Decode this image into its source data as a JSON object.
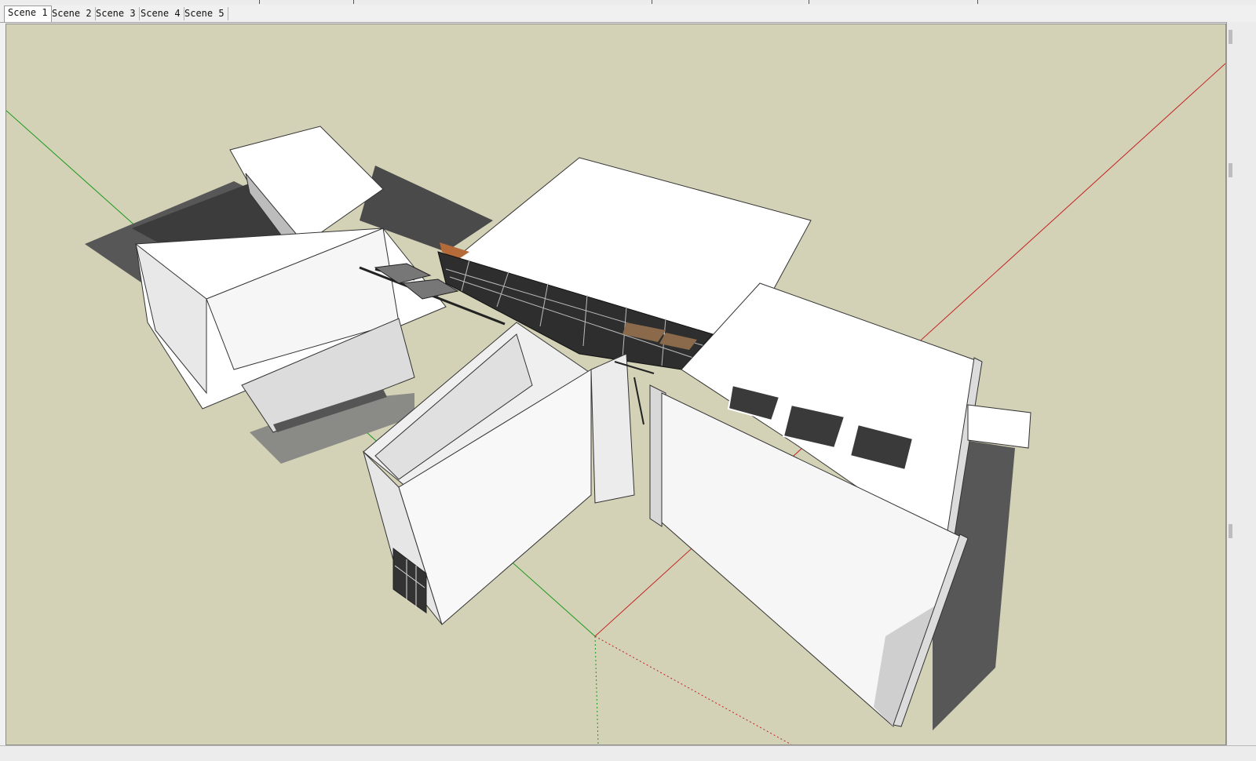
{
  "scene_tabs": [
    {
      "label": "Scene 1",
      "active": true
    },
    {
      "label": "Scene 2",
      "active": false
    },
    {
      "label": "Scene 3",
      "active": false
    },
    {
      "label": "Scene 4",
      "active": false
    },
    {
      "label": "Scene 5",
      "active": false
    }
  ],
  "colors": {
    "ground": "#d3d1b6",
    "x_axis": "#c62020",
    "y_axis": "#1a9a1a",
    "z_axis": "#1010d0",
    "model_face": "#ffffff",
    "shadow": "#575757"
  },
  "icons": [
    "toolbar-icon"
  ]
}
